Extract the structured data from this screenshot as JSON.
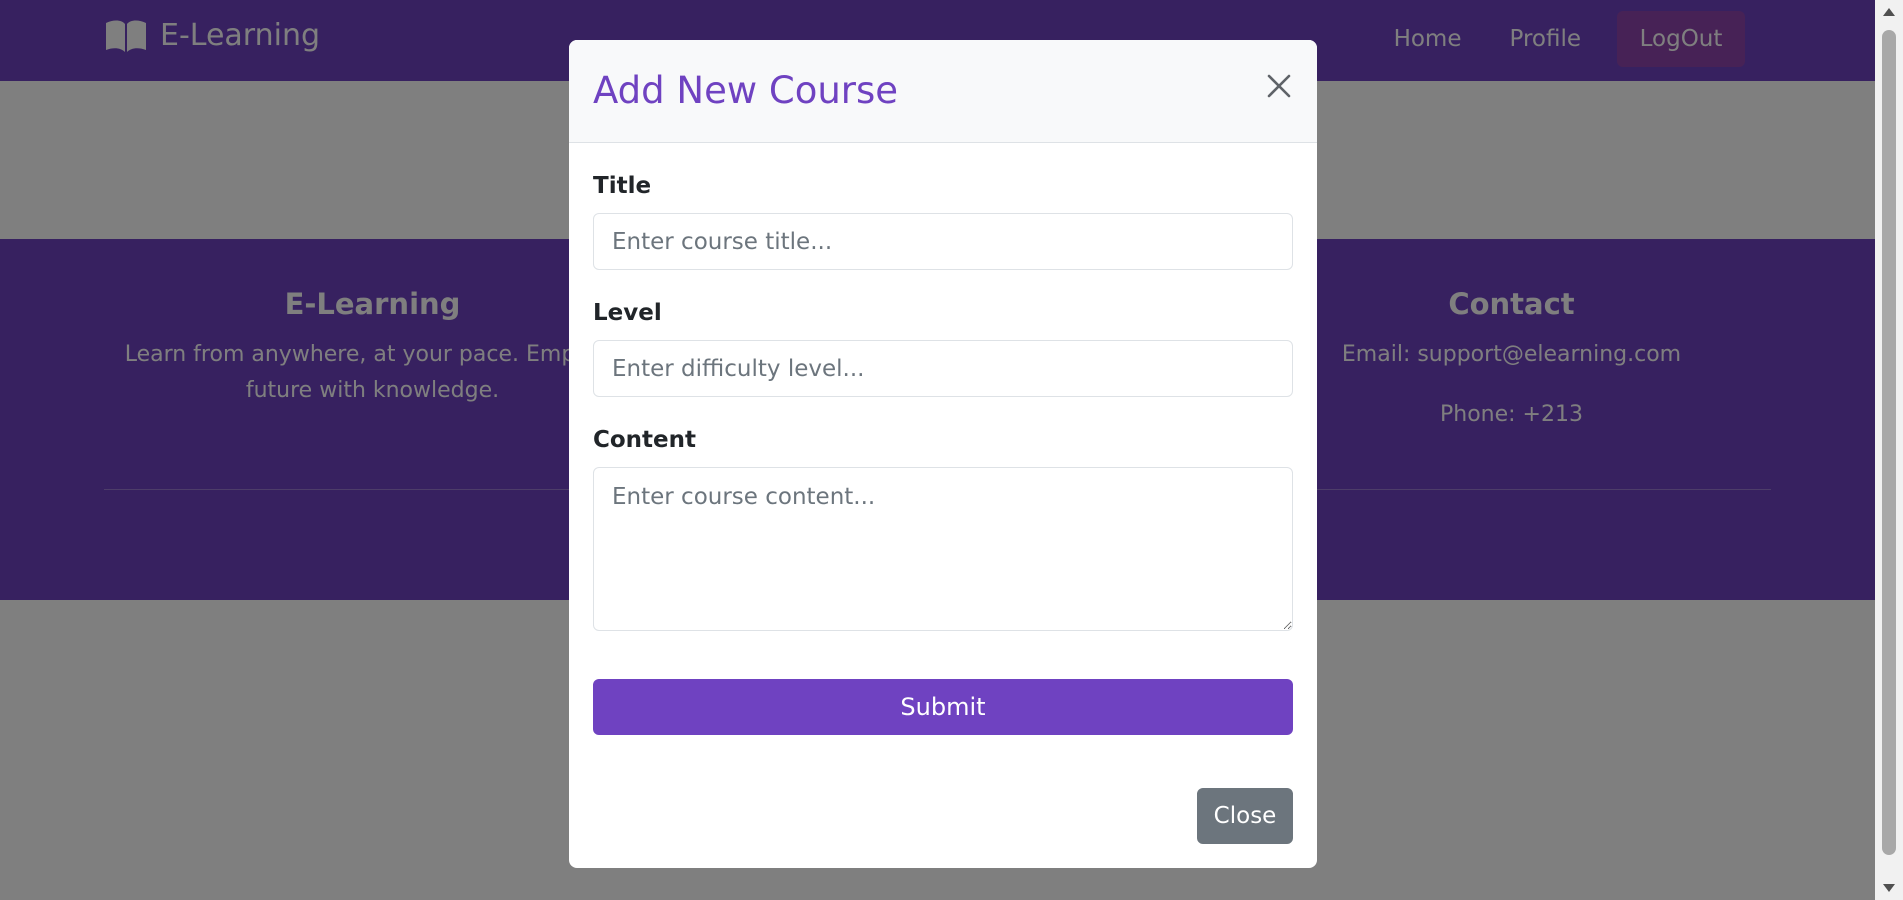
{
  "navbar": {
    "brand": "E-Learning",
    "links": [
      "Home",
      "Profile"
    ],
    "logout_label": "LogOut"
  },
  "footer": {
    "about": {
      "heading": "E-Learning",
      "text_line1": "Learn from anywhere, at your pace. Empowe",
      "text_line2": "future with knowledge."
    },
    "contact": {
      "heading": "Contact",
      "email": "Email: support@elearning.com",
      "phone": "Phone: +213"
    }
  },
  "modal": {
    "title": "Add New Course",
    "fields": {
      "title": {
        "label": "Title",
        "placeholder": "Enter course title..."
      },
      "level": {
        "label": "Level",
        "placeholder": "Enter difficulty level..."
      },
      "content": {
        "label": "Content",
        "placeholder": "Enter course content..."
      }
    },
    "submit_label": "Submit",
    "close_label": "Close"
  },
  "colors": {
    "brand_purple": "#6f42c1",
    "logout_bg": "#8e44ad",
    "close_button": "#6c757d"
  },
  "icons": {
    "brand": "book-icon",
    "close": "close-icon"
  }
}
